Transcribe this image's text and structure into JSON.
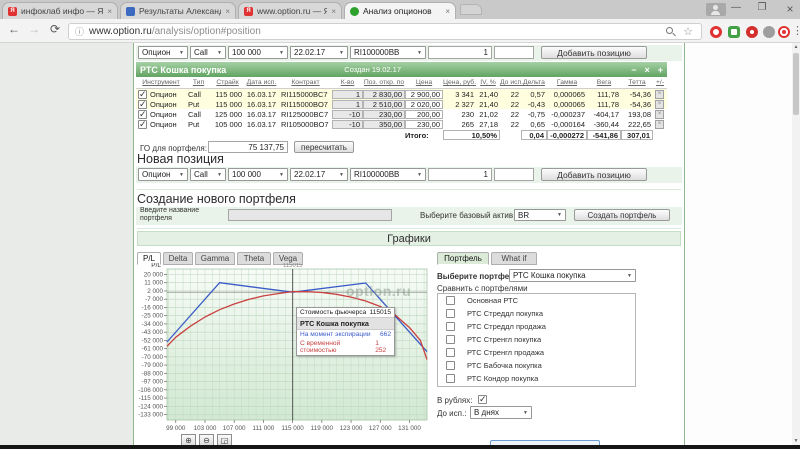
{
  "browser": {
    "tabs": [
      {
        "title": "инфоклаб инфо — Янд",
        "favicon": "yandex-red",
        "close": "×"
      },
      {
        "title": "Результаты Александр К",
        "favicon": "blue-doc",
        "close": "×"
      },
      {
        "title": "www.option.ru — Яндек",
        "favicon": "yandex-red",
        "close": "×"
      },
      {
        "title": "Анализ опционов",
        "favicon": "option-green",
        "close": "×"
      }
    ],
    "url_host": "www.option.ru",
    "url_path": "/analysis/option#position",
    "window_controls": {
      "minimize": "—",
      "maximize": "❐",
      "close": "×"
    }
  },
  "position_form": {
    "instrument": "Опцион",
    "type": "Call",
    "strike": "100 000",
    "date": "22.02.17",
    "contract": "RI100000BB",
    "qty": "1",
    "add_button": "Добавить позицию"
  },
  "portfolio": {
    "title": "РТС Кошка покупка",
    "created": "Создан 19.02.17",
    "columns": {
      "instrument": "Инструмент",
      "type": "Тип",
      "strike": "Страйк",
      "exp": "Дата исп.",
      "contract": "Контракт",
      "qty": "К-во",
      "open": "Поз. откр. по",
      "price": "Цена",
      "price_rub": "Цена, руб.",
      "iv": "IV, %",
      "days": "До исп.",
      "delta": "Дельта",
      "gamma": "Гамма",
      "vega": "Вега",
      "theta": "Тетта",
      "pm": "+/-"
    },
    "rows": [
      {
        "checked": true,
        "instrument": "Опцион",
        "type": "Call",
        "strike": "115 000",
        "exp": "16.03.17",
        "contract": "RI115000BC7",
        "qty": "1",
        "open": "2 830,00",
        "price": "2 900,00",
        "price_rub": "3 341",
        "iv": "21,40",
        "days": "22",
        "delta": "0,57",
        "gamma": "0,000065",
        "vega": "111,78",
        "theta": "-54,36"
      },
      {
        "checked": true,
        "instrument": "Опцион",
        "type": "Put",
        "strike": "115 000",
        "exp": "16.03.17",
        "contract": "RI115000BO7",
        "qty": "1",
        "open": "2 510,00",
        "price": "2 020,00",
        "price_rub": "2 327",
        "iv": "21,40",
        "days": "22",
        "delta": "-0,43",
        "gamma": "0,000065",
        "vega": "111,78",
        "theta": "-54,36"
      },
      {
        "checked": true,
        "instrument": "Опцион",
        "type": "Call",
        "strike": "125 000",
        "exp": "16.03.17",
        "contract": "RI125000BC7",
        "qty": "-10",
        "open": "230,00",
        "price": "200,00",
        "price_rub": "230",
        "iv": "21,02",
        "days": "22",
        "delta": "-0,75",
        "gamma": "-0,000237",
        "vega": "-404,17",
        "theta": "193,08"
      },
      {
        "checked": true,
        "instrument": "Опцион",
        "type": "Put",
        "strike": "105 000",
        "exp": "16.03.17",
        "contract": "RI105000BO7",
        "qty": "-10",
        "open": "350,00",
        "price": "230,00",
        "price_rub": "265",
        "iv": "27,18",
        "days": "22",
        "delta": "0,65",
        "gamma": "-0,000164",
        "vega": "-360,44",
        "theta": "222,65"
      }
    ],
    "totals": {
      "label": "Итого:",
      "iv": "10,50%",
      "delta": "0,04",
      "gamma": "-0,000272",
      "vega": "-541,86",
      "theta": "307,01"
    }
  },
  "go": {
    "label": "ГО для портфеля:",
    "value": "75 137,75",
    "recalc_button": "пересчитать"
  },
  "new_position": {
    "heading": "Новая позиция"
  },
  "create_portfolio": {
    "heading": "Создание нового портфеля",
    "name_label": "Введите название портфеля",
    "asset_label": "Выберите базовый актив",
    "asset": "BR",
    "button": "Создать портфель"
  },
  "charts": {
    "heading": "Графики",
    "tabs": [
      "P/L",
      "Delta",
      "Gamma",
      "Theta",
      "Vega"
    ],
    "active_tab": "P/L",
    "zoom_in": "⊕",
    "zoom_out": "⊖",
    "zoom_reset": "◲"
  },
  "right_panel": {
    "tabs": [
      "Портфель",
      "What if"
    ],
    "active_tab": "Портфель",
    "select_label": "Выберите портфель",
    "selected_portfolio": "РТС Кошка покупка",
    "compare_label": "Сравнить с портфелями",
    "portfolios": [
      "Основная РТС",
      "РТС Стреддл покупка",
      "РТС Стреддл продажа",
      "РТС Стренгл покупка",
      "РТС Стренгл продажа",
      "РТС Бабочка покупка",
      "РТС Кондор покупка"
    ],
    "portfolios_checked": [
      false,
      false,
      false,
      false,
      false,
      false,
      false
    ],
    "rubles_label": "В рублях:",
    "rubles_checked": true,
    "days_label": "До исп.:",
    "days_value": "В днях"
  },
  "chart_data": {
    "type": "line",
    "title": "P/L",
    "x_range": [
      97800,
      133400
    ],
    "y_range": [
      -139000,
      26000
    ],
    "x_ticks": [
      99000,
      103000,
      107000,
      111000,
      115000,
      119000,
      123000,
      127000,
      131000
    ],
    "y_ticks": [
      20000,
      11000,
      2000,
      -7000,
      -16000,
      -25000,
      -34000,
      -43000,
      -52000,
      -61000,
      -70000,
      -79000,
      -88000,
      -97000,
      -106000,
      -115000,
      -124000,
      -133000
    ],
    "x_minor_step": 1000,
    "grid": true,
    "series": [
      {
        "name": "На момент экспирации",
        "color": "#3a5bc7",
        "x": [
          97800,
          105000,
          115015,
          125000,
          133400
        ],
        "y": [
          -53800,
          11000,
          662,
          10650,
          -64400
        ]
      },
      {
        "name": "С временной стоимостью",
        "color": "#c94040",
        "x": [
          97800,
          99000,
          101000,
          103000,
          105000,
          107000,
          109000,
          111000,
          113000,
          115015,
          117000,
          119000,
          121000,
          123000,
          125000,
          127000,
          129000,
          131000,
          132500,
          133400
        ],
        "y": [
          -58500,
          -48500,
          -36500,
          -26500,
          -18500,
          -12200,
          -7200,
          -3400,
          -900,
          1252,
          1200,
          300,
          -1700,
          -4700,
          -9000,
          -15000,
          -24000,
          -38000,
          -52000,
          -73000
        ]
      }
    ],
    "crosshair": {
      "x": 115015,
      "y": 662,
      "top_label": "115015"
    },
    "tooltip": {
      "price_label": "Стоимость фьючерса",
      "price": "115015",
      "title": "РТС Кошка покупка",
      "rows": [
        {
          "label": "На момент экспирации",
          "value": "662"
        },
        {
          "label": "С временной стоимостью",
          "value": "1 252"
        }
      ]
    },
    "watermark": "option.ru",
    "legend_position": "tooltip"
  }
}
